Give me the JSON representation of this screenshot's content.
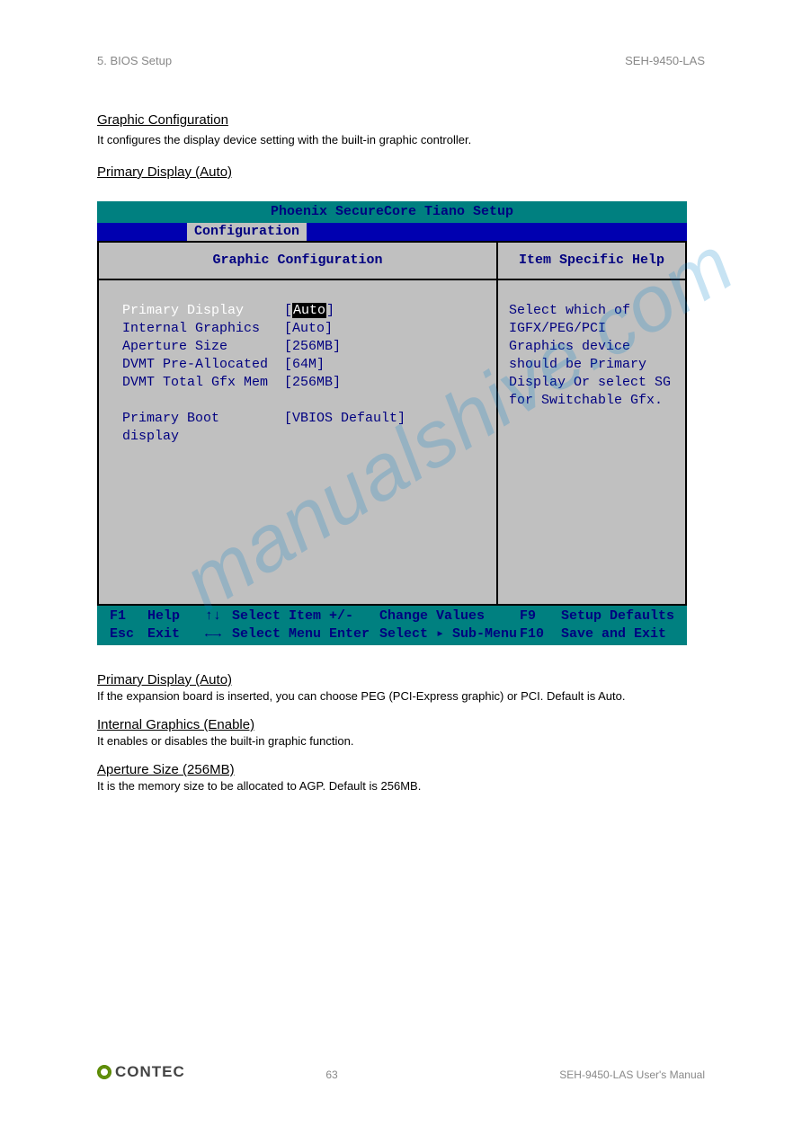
{
  "header": {
    "chapter": "5. BIOS Setup",
    "product": "SEH-9450-LAS"
  },
  "sections": {
    "graphic_conf": {
      "title": "Graphic Configuration",
      "desc": "It configures the display device setting with the built-in graphic controller."
    },
    "primary_display_screen": {
      "title": "Primary Display  (Auto)"
    },
    "primary_display": {
      "title": "Primary Display  (Auto)",
      "desc": "If the expansion board is inserted, you can choose PEG (PCI-Express graphic) or PCI.  Default is Auto."
    },
    "internal_graphics": {
      "title": "Internal Graphics  (Enable)",
      "desc": "It enables or disables the built-in graphic function."
    },
    "aperture_size": {
      "title": "Aperture Size  (256MB)",
      "desc": "It is the memory size to be allocated to AGP.  Default is 256MB."
    }
  },
  "bios": {
    "title": "Phoenix SecureCore Tiano Setup",
    "tab": "Configuration",
    "left_header": "Graphic Configuration",
    "right_header": "Item Specific Help",
    "rows": [
      {
        "label": "Primary Display",
        "value": "[Auto]",
        "selected": true
      },
      {
        "label": "Internal Graphics",
        "value": "[Auto]",
        "selected": false
      },
      {
        "label": "Aperture Size",
        "value": "[256MB]",
        "selected": false
      },
      {
        "label": "DVMT Pre-Allocated",
        "value": "[64M]",
        "selected": false
      },
      {
        "label": "DVMT Total Gfx Mem",
        "value": "[256MB]",
        "selected": false
      }
    ],
    "row2": {
      "label": "Primary Boot display",
      "value": "[VBIOS Default]"
    },
    "help_text": "Select which of IGFX/PEG/PCI Graphics device should be Primary Display Or select SG for Switchable Gfx.",
    "footer": {
      "r1": {
        "k1": "F1",
        "a1": "Help",
        "i1": "↑↓",
        "b1": "Select Item",
        "c1": "+/-",
        "d1": "Change Values",
        "e1": "F9",
        "f1": "Setup Defaults"
      },
      "r2": {
        "k1": "Esc",
        "a1": "Exit",
        "i1": "←→",
        "b1": "Select Menu",
        "c1": "Enter",
        "d1": "Select ▸ Sub-Menu",
        "e1": "F10",
        "f1": "Save and Exit"
      }
    }
  },
  "watermark": "manualshive.com",
  "footer": {
    "brand": "CONTEC",
    "page": "63",
    "doc": "SEH-9450-LAS User's Manual"
  }
}
